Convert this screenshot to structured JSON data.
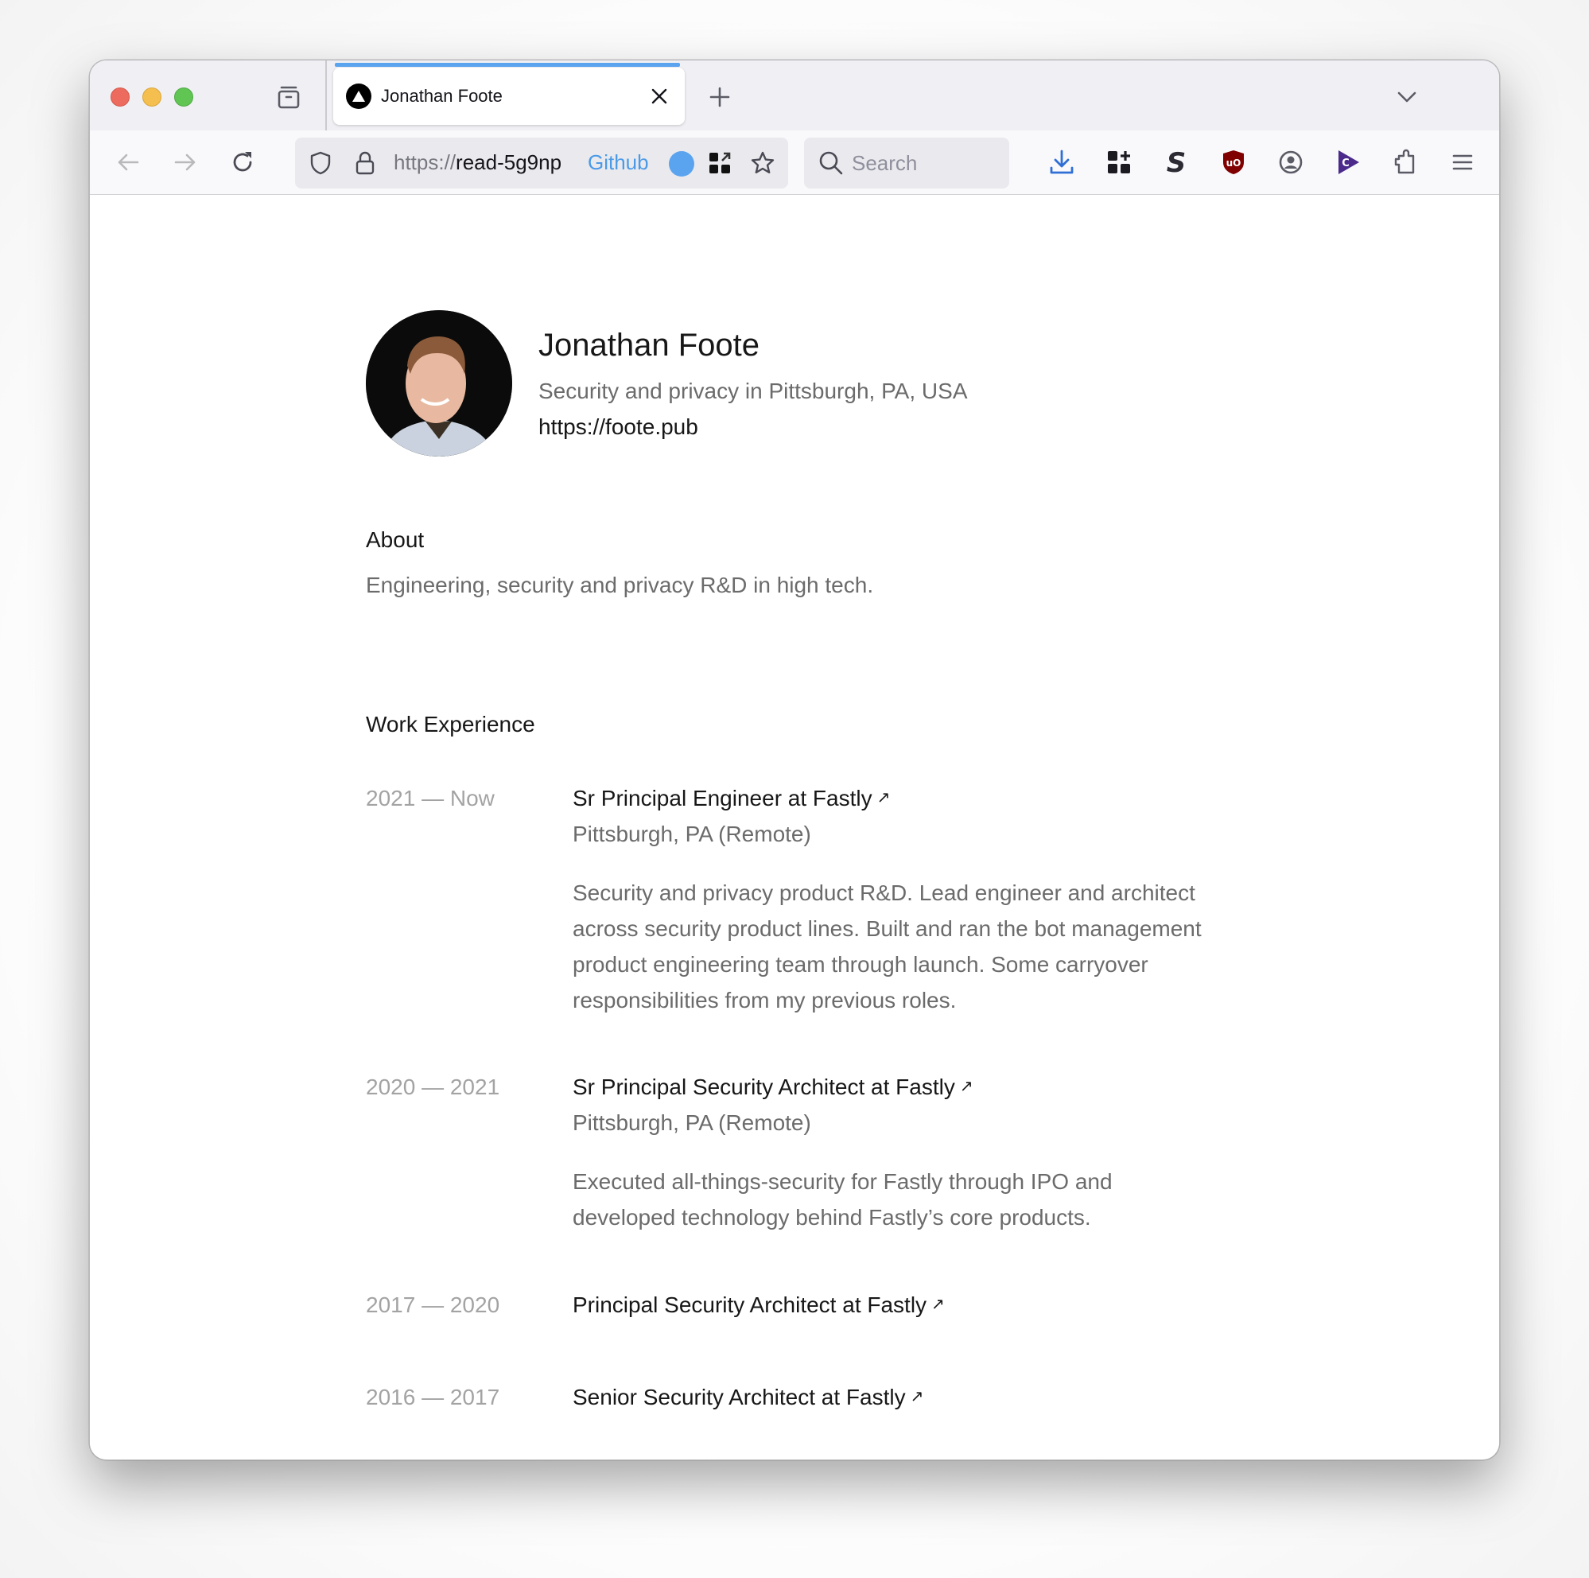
{
  "browser": {
    "tab": {
      "title": "Jonathan Foote",
      "favicon": "triangle-logo-icon",
      "close_icon": "close-icon"
    },
    "new_tab_icon": "plus-icon",
    "tab_list_icon": "chevron-down-icon",
    "tab_groups_icon": "tab-tray-icon",
    "nav": {
      "back_icon": "arrow-left-icon",
      "forward_icon": "arrow-right-icon",
      "reload_icon": "reload-icon"
    },
    "urlbar": {
      "url_scheme": "https://",
      "url_host": "read-5g9np",
      "shield_icon": "shield-icon",
      "lock_icon": "lock-icon",
      "github_label": "Github",
      "qr_icon": "grid-share-icon",
      "bookmark_icon": "star-icon"
    },
    "search": {
      "placeholder": "Search",
      "value": ""
    },
    "toolbar_icons": [
      {
        "name": "download-icon",
        "color": "#2f6fd6"
      },
      {
        "name": "add-grid-icon",
        "color": "#1c1b22"
      },
      {
        "name": "s-extension-icon",
        "color": "#2c2b33"
      },
      {
        "name": "ublock-origin-icon",
        "color": "#800000"
      },
      {
        "name": "account-icon",
        "color": "#5b5b66"
      },
      {
        "name": "c-play-extension-icon",
        "color": "#4b2a8c"
      },
      {
        "name": "extensions-puzzle-icon",
        "color": "#5b5b66"
      },
      {
        "name": "menu-icon",
        "color": "#5b5b66"
      }
    ]
  },
  "profile": {
    "name": "Jonathan Foote",
    "tagline": "Security and privacy in Pittsburgh, PA, USA",
    "website": "https://foote.pub"
  },
  "about": {
    "heading": "About",
    "text": "Engineering, security and privacy R&D in high tech."
  },
  "work": {
    "heading": "Work Experience",
    "link_arrow": "↗",
    "jobs": [
      {
        "dates": "2021 — Now",
        "title": "Sr Principal Engineer at Fastly",
        "location": "Pittsburgh, PA (Remote)",
        "description": "Security and privacy product R&D. Lead engineer and architect across security product lines. Built and ran the bot management product engineering team through launch. Some carryover responsibilities from my previous roles."
      },
      {
        "dates": "2020 — 2021",
        "title": "Sr Principal Security Architect at Fastly",
        "location": "Pittsburgh, PA (Remote)",
        "description": "Executed all-things-security for Fastly through IPO and developed technology behind Fastly’s core products."
      },
      {
        "dates": "2017 — 2020",
        "title": "Principal Security Architect at Fastly"
      },
      {
        "dates": "2016 — 2017",
        "title": "Senior Security Architect at Fastly"
      }
    ]
  }
}
